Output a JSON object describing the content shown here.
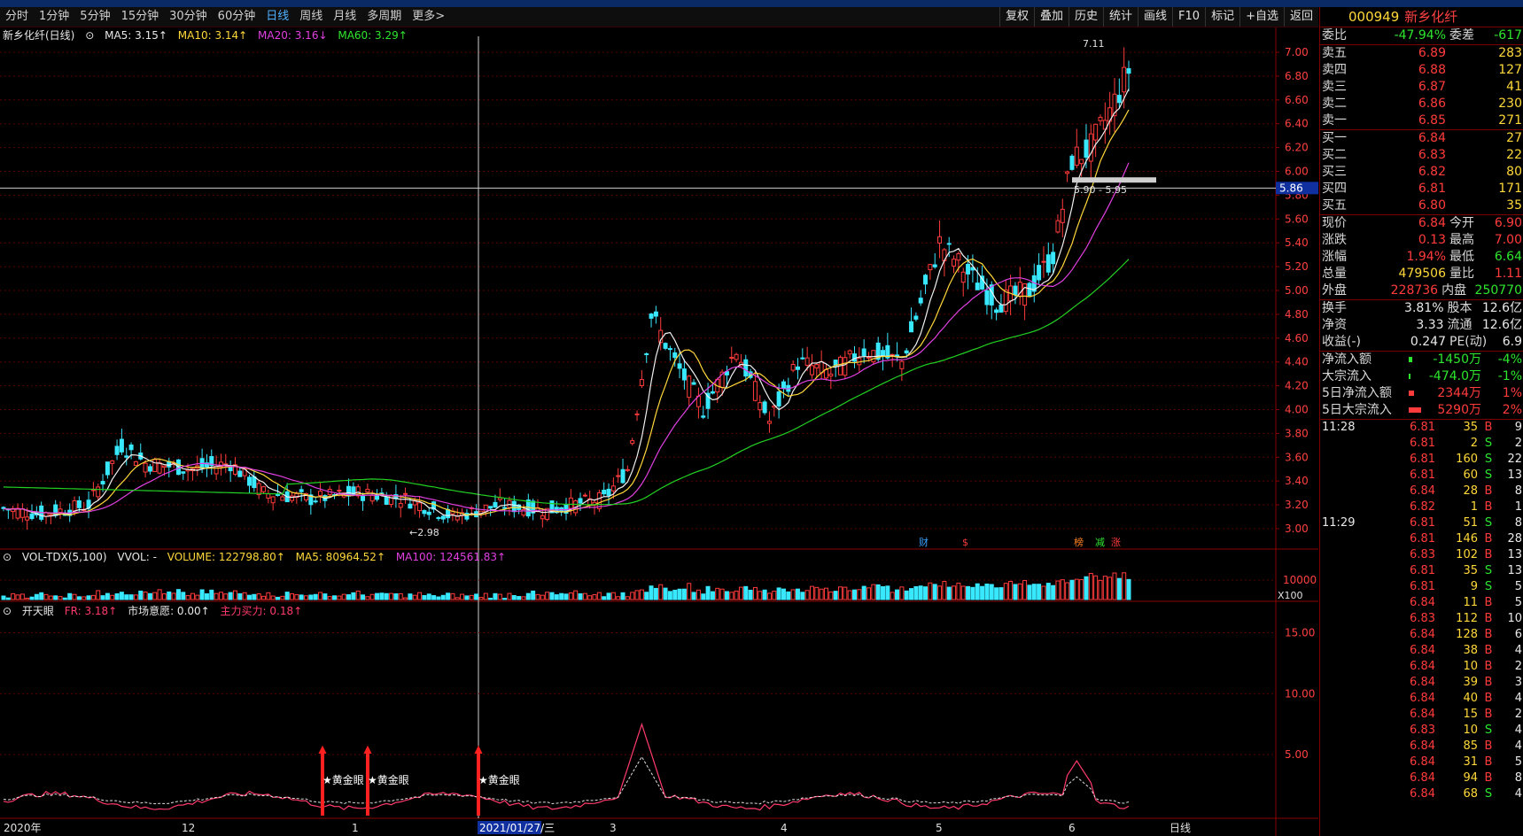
{
  "toolbar": {
    "periods": [
      "分时",
      "1分钟",
      "5分钟",
      "15分钟",
      "30分钟",
      "60分钟",
      "日线",
      "周线",
      "月线",
      "多周期",
      "更多>"
    ],
    "active": "日线",
    "right_buttons": [
      "复权",
      "叠加",
      "历史",
      "统计",
      "画线",
      "F10",
      "标记",
      "+自选",
      "返回"
    ]
  },
  "stock": {
    "code": "000949",
    "name": "新乡化纤"
  },
  "main_chart": {
    "title": "新乡化纤(日线)",
    "ma5": "MA5: 3.15↑",
    "ma10": "MA10: 3.14↑",
    "ma20": "MA20: 3.16↓",
    "ma60": "MA60: 3.29↑",
    "y_ticks": [
      "7.00",
      "6.80",
      "6.60",
      "6.40",
      "6.20",
      "6.00",
      "5.80",
      "5.60",
      "5.40",
      "5.20",
      "5.00",
      "4.80",
      "4.60",
      "4.40",
      "4.20",
      "4.00",
      "3.80",
      "3.60",
      "3.40",
      "3.20",
      "3.00"
    ],
    "cursor_price": "5.86",
    "high_label": "7.11",
    "low_label": "2.98",
    "gap_label": "5.90 - 5.95",
    "event_markers": [
      "财",
      "$",
      "榜",
      "减",
      "涨"
    ],
    "x_labels": [
      "2020年",
      "12",
      "1",
      "2021/01/27/三",
      "3",
      "4",
      "5",
      "6",
      "日线"
    ]
  },
  "volume_chart": {
    "title": "VOL-TDX(5,100)",
    "vvol": "VVOL: -",
    "volume": "VOLUME: 122798.80↑",
    "ma5": "MA5: 80964.52↑",
    "ma100": "MA100: 124561.83↑",
    "y_tick": "10000",
    "unit": "X100"
  },
  "indicator_chart": {
    "title": "开天眼",
    "fr": "FR: 3.18↑",
    "will": "市场意愿: 0.00↑",
    "force": "主力买力: 0.18↑",
    "y_ticks": [
      "15.00",
      "10.00",
      "5.00"
    ],
    "signal_label": "★黄金眼"
  },
  "order_book": {
    "ratio_label": "委比",
    "ratio": "-47.94%",
    "diff_label": "委差",
    "diff": "-617",
    "asks": [
      {
        "label": "卖五",
        "price": "6.89",
        "vol": "283"
      },
      {
        "label": "卖四",
        "price": "6.88",
        "vol": "127"
      },
      {
        "label": "卖三",
        "price": "6.87",
        "vol": "41"
      },
      {
        "label": "卖二",
        "price": "6.86",
        "vol": "230"
      },
      {
        "label": "卖一",
        "price": "6.85",
        "vol": "271"
      }
    ],
    "bids": [
      {
        "label": "买一",
        "price": "6.84",
        "vol": "27"
      },
      {
        "label": "买二",
        "price": "6.83",
        "vol": "22"
      },
      {
        "label": "买三",
        "price": "6.82",
        "vol": "80"
      },
      {
        "label": "买四",
        "price": "6.81",
        "vol": "171"
      },
      {
        "label": "买五",
        "price": "6.80",
        "vol": "35"
      }
    ]
  },
  "quote": [
    {
      "l1": "现价",
      "v1": "6.84",
      "c1": "red",
      "l2": "今开",
      "v2": "6.90",
      "c2": "red"
    },
    {
      "l1": "涨跌",
      "v1": "0.13",
      "c1": "red",
      "l2": "最高",
      "v2": "7.00",
      "c2": "red"
    },
    {
      "l1": "涨幅",
      "v1": "1.94%",
      "c1": "red",
      "l2": "最低",
      "v2": "6.64",
      "c2": "green"
    },
    {
      "l1": "总量",
      "v1": "479506",
      "c1": "yellow",
      "l2": "量比",
      "v2": "1.11",
      "c2": "red"
    },
    {
      "l1": "外盘",
      "v1": "228736",
      "c1": "red",
      "l2": "内盘",
      "v2": "250770",
      "c2": "green"
    }
  ],
  "fundamentals": [
    {
      "l1": "换手",
      "v1": "3.81%",
      "l2": "股本",
      "v2": "12.6亿"
    },
    {
      "l1": "净资",
      "v1": "3.33",
      "l2": "流通",
      "v2": "12.6亿"
    },
    {
      "l1": "收益(-)",
      "v1": "0.247",
      "l2": "PE(动)",
      "v2": "6.9"
    }
  ],
  "money_flow": [
    {
      "label": "净流入额",
      "val": "-1450万",
      "pct": "-4%",
      "color": "green",
      "bar": 4
    },
    {
      "label": "大宗流入",
      "val": "-474.0万",
      "pct": "-1%",
      "color": "green",
      "bar": 2
    },
    {
      "label": "5日净流入额",
      "val": "2344万",
      "pct": "1%",
      "color": "red",
      "bar": 6
    },
    {
      "label": "5日大宗流入",
      "val": "5290万",
      "pct": "2%",
      "color": "red",
      "bar": 14
    }
  ],
  "ticks": [
    {
      "time": "11:28",
      "price": "6.81",
      "vol": "35",
      "side": "B",
      "n": "9"
    },
    {
      "time": "",
      "price": "6.81",
      "vol": "2",
      "side": "S",
      "n": "2"
    },
    {
      "time": "",
      "price": "6.81",
      "vol": "160",
      "side": "S",
      "n": "22"
    },
    {
      "time": "",
      "price": "6.81",
      "vol": "60",
      "side": "S",
      "n": "13"
    },
    {
      "time": "",
      "price": "6.84",
      "vol": "28",
      "side": "B",
      "n": "8"
    },
    {
      "time": "",
      "price": "6.82",
      "vol": "1",
      "side": "B",
      "n": "1"
    },
    {
      "time": "11:29",
      "price": "6.81",
      "vol": "51",
      "side": "S",
      "n": "8"
    },
    {
      "time": "",
      "price": "6.81",
      "vol": "146",
      "side": "B",
      "n": "28"
    },
    {
      "time": "",
      "price": "6.83",
      "vol": "102",
      "side": "B",
      "n": "13"
    },
    {
      "time": "",
      "price": "6.81",
      "vol": "35",
      "side": "S",
      "n": "13"
    },
    {
      "time": "",
      "price": "6.81",
      "vol": "9",
      "side": "S",
      "n": "5"
    },
    {
      "time": "",
      "price": "6.84",
      "vol": "11",
      "side": "B",
      "n": "5"
    },
    {
      "time": "",
      "price": "6.83",
      "vol": "112",
      "side": "B",
      "n": "10"
    },
    {
      "time": "",
      "price": "6.84",
      "vol": "128",
      "side": "B",
      "n": "6"
    },
    {
      "time": "",
      "price": "6.84",
      "vol": "38",
      "side": "B",
      "n": "4"
    },
    {
      "time": "",
      "price": "6.84",
      "vol": "10",
      "side": "B",
      "n": "2"
    },
    {
      "time": "",
      "price": "6.84",
      "vol": "39",
      "side": "B",
      "n": "3"
    },
    {
      "time": "",
      "price": "6.84",
      "vol": "40",
      "side": "B",
      "n": "4"
    },
    {
      "time": "",
      "price": "6.84",
      "vol": "15",
      "side": "B",
      "n": "2"
    },
    {
      "time": "",
      "price": "6.83",
      "vol": "10",
      "side": "S",
      "n": "4"
    },
    {
      "time": "",
      "price": "6.84",
      "vol": "85",
      "side": "B",
      "n": "4"
    },
    {
      "time": "",
      "price": "6.84",
      "vol": "31",
      "side": "B",
      "n": "5"
    },
    {
      "time": "",
      "price": "6.84",
      "vol": "94",
      "side": "B",
      "n": "8"
    },
    {
      "time": "",
      "price": "6.84",
      "vol": "68",
      "side": "S",
      "n": "4"
    }
  ]
}
